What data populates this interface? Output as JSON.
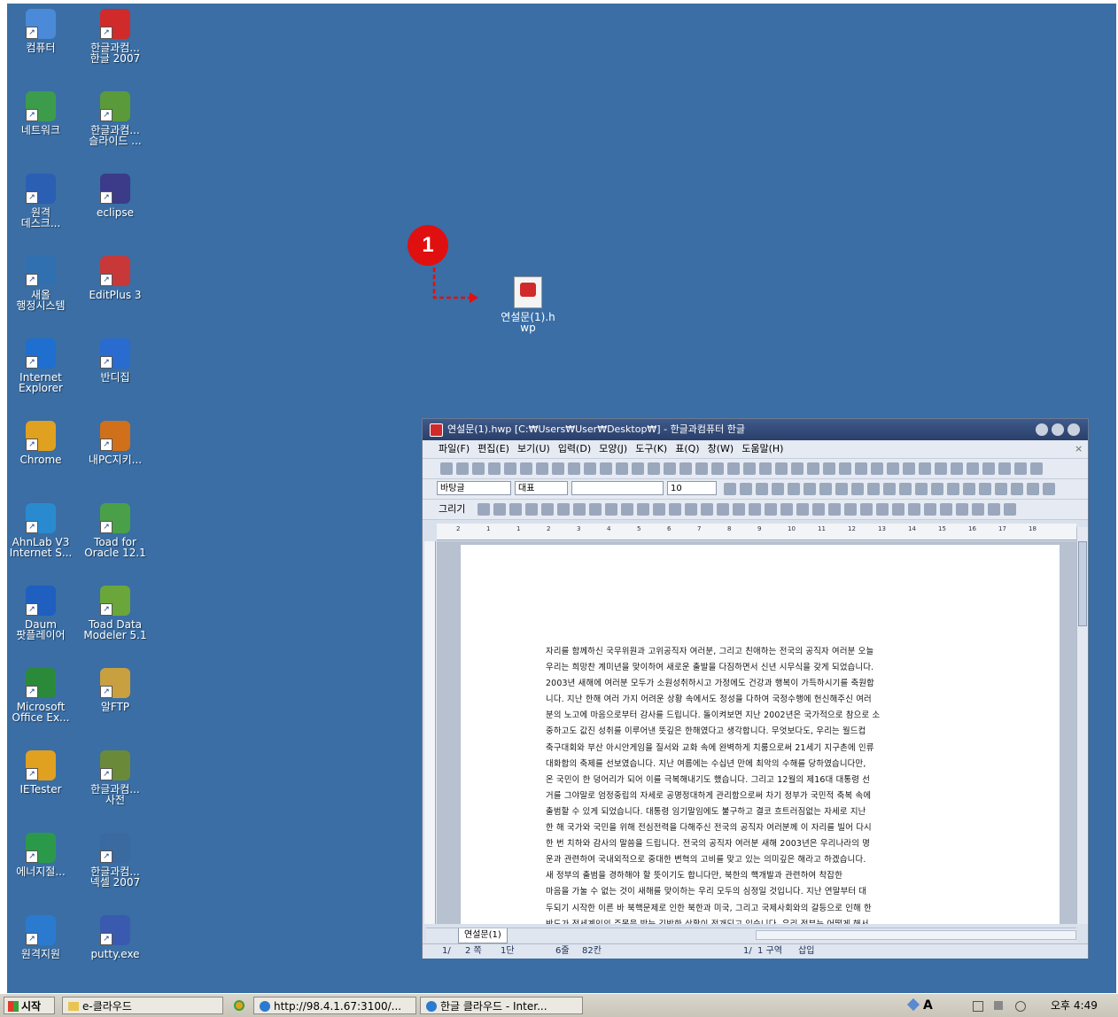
{
  "desktop_icons": [
    {
      "id": "computer",
      "label": "컴퓨터",
      "icon": "computer-icon",
      "color": "#4a8ad8"
    },
    {
      "id": "hancom-hangul",
      "label": "한글과컴...\n한글 2007",
      "icon": "hangul-icon",
      "color": "#d02a2a"
    },
    {
      "id": "network",
      "label": "네트워크",
      "icon": "network-icon",
      "color": "#3c9c4c"
    },
    {
      "id": "hancom-slide",
      "label": "한글과컴...\n슬라이드 ...",
      "icon": "slide-icon",
      "color": "#5a9a3a"
    },
    {
      "id": "remote-desktop",
      "label": "원격\n데스크...",
      "icon": "remote-desktop-icon",
      "color": "#2b5fb3"
    },
    {
      "id": "eclipse",
      "label": "eclipse",
      "icon": "eclipse-icon",
      "color": "#3b3b8a"
    },
    {
      "id": "saeol",
      "label": "새올\n행정시스템",
      "icon": "saeol-icon",
      "color": "#3070b0"
    },
    {
      "id": "editplus",
      "label": "EditPlus 3",
      "icon": "editplus-icon",
      "color": "#c83838"
    },
    {
      "id": "ie",
      "label": "Internet\nExplorer",
      "icon": "internet-explorer-icon",
      "color": "#1e6fd0"
    },
    {
      "id": "bandizip",
      "label": "반디집",
      "icon": "bandizip-icon",
      "color": "#2a6bd0"
    },
    {
      "id": "chrome",
      "label": "Chrome",
      "icon": "chrome-icon",
      "color": "#e0a020"
    },
    {
      "id": "mypc",
      "label": "내PC지키...",
      "icon": "shield-icon",
      "color": "#d0701a"
    },
    {
      "id": "ahnlab",
      "label": "AhnLab V3\nInternet S...",
      "icon": "ahnlab-icon",
      "color": "#2a8ad0"
    },
    {
      "id": "toad-oracle",
      "label": "Toad for\nOracle 12.1",
      "icon": "toad-icon",
      "color": "#4aa048"
    },
    {
      "id": "daum-potplayer",
      "label": "Daum\n팟플레이어",
      "icon": "potplayer-icon",
      "color": "#1e5fc0"
    },
    {
      "id": "toad-data-modeler",
      "label": "Toad Data\nModeler 5.1",
      "icon": "toad-modeler-icon",
      "color": "#6aa63a"
    },
    {
      "id": "excel",
      "label": "Microsoft\nOffice Ex...",
      "icon": "excel-icon",
      "color": "#2a8a3a"
    },
    {
      "id": "alftp",
      "label": "알FTP",
      "icon": "alftp-icon",
      "color": "#c8a040"
    },
    {
      "id": "ietester",
      "label": "IETester",
      "icon": "ietester-icon",
      "color": "#e0a020"
    },
    {
      "id": "hancom-dict",
      "label": "한글과컴...\n사전",
      "icon": "dictionary-icon",
      "color": "#6a8a3a"
    },
    {
      "id": "energy",
      "label": "에너지절...",
      "icon": "globe-icon",
      "color": "#2a9a4a"
    },
    {
      "id": "hancom-nexcel",
      "label": "한글과컴...\n넥셀 2007",
      "icon": "nexcel-icon",
      "color": "#3a6aa0"
    },
    {
      "id": "remote-support",
      "label": "원격지원",
      "icon": "remote-support-icon",
      "color": "#2a7ad0"
    },
    {
      "id": "putty",
      "label": "putty.exe",
      "icon": "putty-icon",
      "color": "#3a5ab0"
    }
  ],
  "callout": {
    "number": "1",
    "color": "#e01010"
  },
  "dragged_file": {
    "label": "연설문(1).h\nwp",
    "icon": "hwp-file-icon"
  },
  "hwp_window": {
    "title": "연설문(1).hwp [C:₩Users₩User₩Desktop₩] - 한글과컴퓨터 한글",
    "close_x": "×",
    "menu": [
      "파일(F)",
      "편집(E)",
      "보기(U)",
      "입력(D)",
      "모양(J)",
      "도구(K)",
      "표(Q)",
      "창(W)",
      "도움말(H)"
    ],
    "style_value": "바탕글",
    "lang_value": "대표",
    "font_value": "",
    "size_value": "10",
    "draw_label": "그리기",
    "ruler_numbers": [
      "2",
      "1",
      "1",
      "2",
      "3",
      "4",
      "5",
      "6",
      "7",
      "8",
      "9",
      "10",
      "11",
      "12",
      "13",
      "14",
      "15",
      "16",
      "17",
      "18"
    ],
    "doc_lines": [
      "자리를 함께하신 국무위원과 고위공직자 여러분, 그리고 친애하는 전국의 공직자 여러분 오늘",
      "우리는 희망찬 계미년을 맞이하여 새로운 출발을 다짐하면서 신년 시무식을 갖게 되었습니다.",
      "2003년 새해에 여러분 모두가 소원성취하시고 가정에도 건강과 행복이 가득하시기를 축원합",
      "니다. 지난 한해 여러 가지 어려운 상황 속에서도 정성을 다하여 국정수행에 헌신해주신 여러",
      "분의 노고에 마음으로부터 감사를 드립니다. 돌이켜보면 지난 2002년은 국가적으로 참으로 소",
      "중하고도 값진 성취를 이루어낸 뜻깊은 한해였다고 생각합니다. 무엇보다도, 우리는 월드컵",
      "축구대회와 부산 아시안게임을 질서와 교화 속에 완벽하게 치룸으로써 21세기 지구촌에 인류",
      "대화합의 축제를 선보였습니다. 지난 여름에는 수십년 만에 최악의 수해를 당하였습니다만,",
      "온 국민이 한 덩어리가 되어 이를 극복해내기도 했습니다. 그리고 12월의 제16대 대통령 선",
      "거를 그야말로 엄정중립의 자세로 공명정대하게 관리함으로써 차기 정부가 국민적 축복 속에",
      "출범할 수 있게 되었습니다. 대통령 임기말임에도 불구하고 결코 흐트러짐없는 자세로 지난",
      "한 해 국가와 국민을 위해 전심전력을 다해주신 전국의 공직자 여러분께 이 자리를 빌어 다시",
      "한 번 치하와 감사의 말씀을 드립니다. 전국의 공직자 여러분 새해 2003년은 우리나라의 명",
      "운과 관련하여 국내외적으로 중대한 변혁의 고비를 맞고 있는 의미깊은 해라고 하겠습니다.",
      "새 정부의 출범을 경하해야 할 뜻이기도 합니다만, 북한의 핵개발과 관련하여 착잡한",
      "마음을 가눌 수 없는 것이 새해를 맞이하는 우리 모두의 심정일 것입니다. 지난 연말부터 대",
      "두되기 시작한 이른 바 북핵문제로 인한 북한과 미국, 그리고 국제사회와의 갈등으로 인해 한",
      "반도가 전세계인의 주목을 받는 긴박한 상황이 전개되고 있습니다. 우리 정부는 어떻게 해서"
    ],
    "sheet_tab": "연설문(1)",
    "status": {
      "page": "1/",
      "pages": "2 쪽",
      "section": "1단",
      "line": "6줄",
      "col": "82칸",
      "section2": "1/",
      "area": "1 구역",
      "mode": "삽입"
    }
  },
  "taskbar": {
    "start": "시작",
    "items": [
      {
        "label": "e-클라우드",
        "icon": "folder-icon"
      },
      {
        "label": "http://98.4.1.67:3100/...",
        "icon": "ie-icon"
      },
      {
        "label": "한글 클라우드 - Inter...",
        "icon": "ie-icon"
      }
    ],
    "clock": "오후 4:49",
    "ime": "A"
  }
}
